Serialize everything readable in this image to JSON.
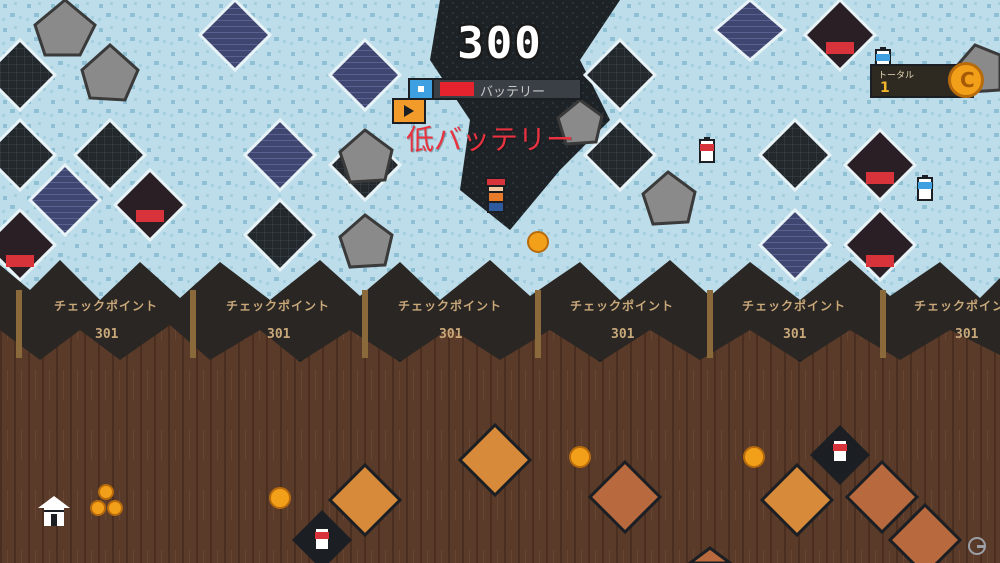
{
  "hud": {
    "score": "300",
    "battery_label": "バッテリー",
    "low_battery_warning": "低バッテリー",
    "battery_level": 0.24
  },
  "total": {
    "label": "トータル",
    "value": "1"
  },
  "checkpoint": {
    "label": "チェックポイント",
    "number": "301"
  },
  "icons": {
    "home": "home-icon",
    "coin": "coin-icon",
    "pickaxe": "pickaxe-icon",
    "battery": "battery-icon"
  },
  "colors": {
    "ice": "#bcdde9",
    "dirt": "#5a3a28",
    "checkpoint_band": "#2a2623",
    "coin": "#f2a019",
    "warning": "#e8323f"
  }
}
